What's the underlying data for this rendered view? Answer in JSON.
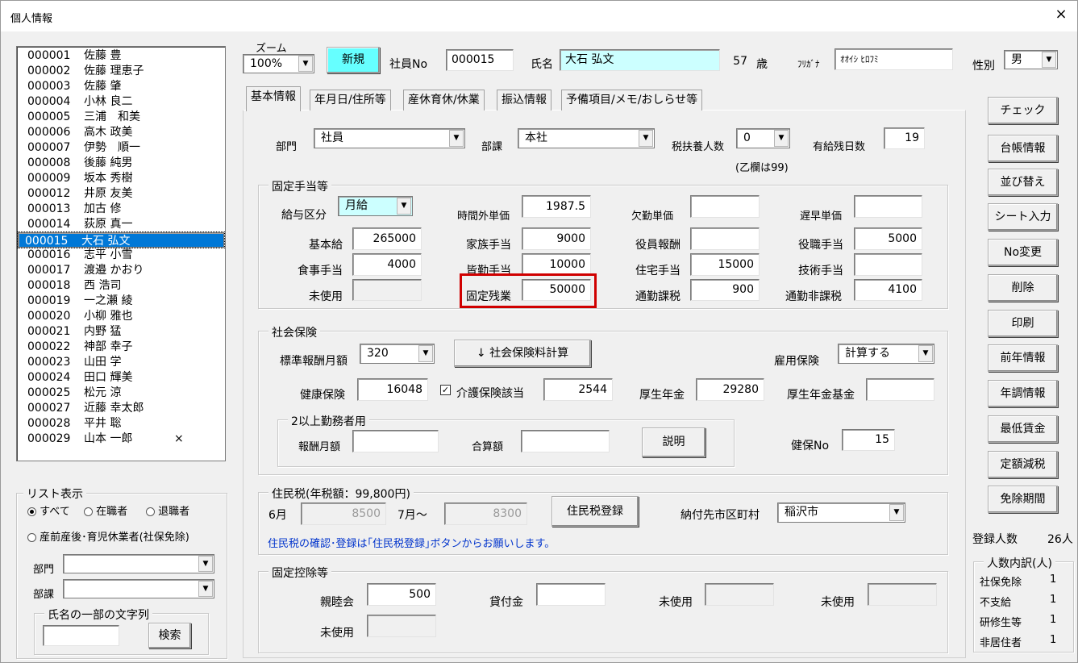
{
  "window": {
    "title": "個人情報",
    "close": "×"
  },
  "employees": [
    {
      "no": "000001",
      "name": "佐藤 豊"
    },
    {
      "no": "000002",
      "name": "佐藤 理恵子"
    },
    {
      "no": "000003",
      "name": "佐藤 肇"
    },
    {
      "no": "000004",
      "name": "小林 良二"
    },
    {
      "no": "000005",
      "name": "三浦　和美"
    },
    {
      "no": "000006",
      "name": "高木 政美"
    },
    {
      "no": "000007",
      "name": "伊勢　順一"
    },
    {
      "no": "000008",
      "name": "後藤 純男"
    },
    {
      "no": "000009",
      "name": "坂本 秀樹"
    },
    {
      "no": "000012",
      "name": "井原 友美"
    },
    {
      "no": "000013",
      "name": "加古 修"
    },
    {
      "no": "000014",
      "name": "荻原 真一"
    },
    {
      "no": "000015",
      "name": "大石 弘文",
      "selected": true
    },
    {
      "no": "000016",
      "name": "志平 小雪"
    },
    {
      "no": "000017",
      "name": "渡邉 かおり"
    },
    {
      "no": "000018",
      "name": "西 浩司"
    },
    {
      "no": "000019",
      "name": "一之瀬 綾"
    },
    {
      "no": "000020",
      "name": "小柳 雅也"
    },
    {
      "no": "000021",
      "name": "内野 猛"
    },
    {
      "no": "000022",
      "name": "神部 幸子"
    },
    {
      "no": "000023",
      "name": "山田 学"
    },
    {
      "no": "000024",
      "name": "田口 輝美"
    },
    {
      "no": "000025",
      "name": "松元 涼"
    },
    {
      "no": "000027",
      "name": "近藤 幸太郎"
    },
    {
      "no": "000028",
      "name": "平井 聡"
    },
    {
      "no": "000029",
      "name": "山本 一郎",
      "mark": "×"
    }
  ],
  "list_filter": {
    "title": "リスト表示",
    "radio_all": "すべて",
    "radio_active": "在職者",
    "radio_retired": "退職者",
    "radio_leave": "産前産後･育児休業者(社保免除)",
    "dept_label": "部門",
    "section_label": "部課",
    "name_search_title": "氏名の一部の文字列",
    "search_button": "検索"
  },
  "header": {
    "zoom_label": "ズーム",
    "zoom_value": "100%",
    "new_button": "新規",
    "empno_label": "社員No",
    "empno_value": "000015",
    "name_label": "氏名",
    "name_value": "大石 弘文",
    "age_value": "57",
    "age_unit": "歳",
    "kana_label": "ﾌﾘｶﾞﾅ",
    "kana_value": "ｵｵｲｼ ﾋﾛﾌﾐ",
    "gender_label": "性別",
    "gender_value": "男"
  },
  "tabs": [
    "基本情報",
    "年月日/住所等",
    "産休育休/休業",
    "振込情報",
    "予備項目/メモ/おしらせ等"
  ],
  "basic": {
    "dept_label": "部門",
    "dept_value": "社員",
    "section_label": "部課",
    "section_value": "本社",
    "dependents_label": "税扶養人数",
    "dependents_value": "0",
    "dependents_note": "(乙欄は99)",
    "paid_leave_label": "有給残日数",
    "paid_leave_value": "19"
  },
  "fixed_allowance": {
    "title": "固定手当等",
    "pay_type_label": "給与区分",
    "pay_type_value": "月給",
    "overtime_rate_label": "時間外単価",
    "overtime_rate_value": "1987.5",
    "absence_rate_label": "欠勤単価",
    "absence_rate_value": "",
    "late_rate_label": "遅早単価",
    "late_rate_value": "",
    "base_pay_label": "基本給",
    "base_pay_value": "265000",
    "family_label": "家族手当",
    "family_value": "9000",
    "officer_label": "役員報酬",
    "officer_value": "",
    "position_label": "役職手当",
    "position_value": "5000",
    "meal_label": "食事手当",
    "meal_value": "4000",
    "attendance_label": "皆勤手当",
    "attendance_value": "10000",
    "housing_label": "住宅手当",
    "housing_value": "15000",
    "skill_label": "技術手当",
    "skill_value": "",
    "unused_label": "未使用",
    "unused_value": "",
    "fixed_ot_label": "固定残業",
    "fixed_ot_value": "50000",
    "commute_tax_label": "通勤課税",
    "commute_tax_value": "900",
    "commute_nontax_label": "通勤非課税",
    "commute_nontax_value": "4100"
  },
  "social_insurance": {
    "title": "社会保険",
    "std_monthly_label": "標準報酬月額",
    "std_monthly_value": "320",
    "calc_button": "↓ 社会保険料計算",
    "employment_label": "雇用保険",
    "employment_value": "計算する",
    "health_label": "健康保険",
    "health_value": "16048",
    "care_label": "介護保険該当",
    "care_checked": "✓",
    "care_value": "2544",
    "pension_label": "厚生年金",
    "pension_value": "29280",
    "pension_fund_label": "厚生年金基金",
    "pension_fund_value": "",
    "multi_title": "2以上勤務者用",
    "multi_pay_label": "報酬月額",
    "multi_total_label": "合算額",
    "explain_button": "説明",
    "health_no_label": "健保No",
    "health_no_value": "15"
  },
  "resident_tax": {
    "title": "住民税(年税額：99,800円)",
    "june_label": "6月",
    "june_value": "8500",
    "july_label": "7月～",
    "july_value": "8300",
    "register_button": "住民税登録",
    "city_label": "納付先市区町村",
    "city_value": "稲沢市",
    "note": "住民税の確認･登録は｢住民税登録｣ボタンからお願いします。"
  },
  "fixed_deduction": {
    "title": "固定控除等",
    "social_label": "親睦会",
    "social_value": "500",
    "loan_label": "貸付金",
    "loan_value": "",
    "unused1_label": "未使用",
    "unused2_label": "未使用",
    "unused3_label": "未使用"
  },
  "side_buttons": [
    "チェック",
    "台帳情報",
    "並び替え",
    "シート入力",
    "No変更",
    "削除",
    "印刷",
    "前年情報",
    "年調情報",
    "最低賃金",
    "定額減税",
    "免除期間"
  ],
  "summary": {
    "registered_label": "登録人数",
    "registered_value": "26人",
    "breakdown_title": "人数内訳(人)",
    "rows": [
      {
        "label": "社保免除",
        "value": "1"
      },
      {
        "label": "不支給",
        "value": "1"
      },
      {
        "label": "研修生等",
        "value": "1"
      },
      {
        "label": "非居住者",
        "value": "1"
      }
    ]
  },
  "colors": {
    "selection": "#0078d7",
    "name_field": "#ccffff",
    "new_button": "#66ffff",
    "highlight": "#d00000",
    "note": "#0033cc"
  }
}
